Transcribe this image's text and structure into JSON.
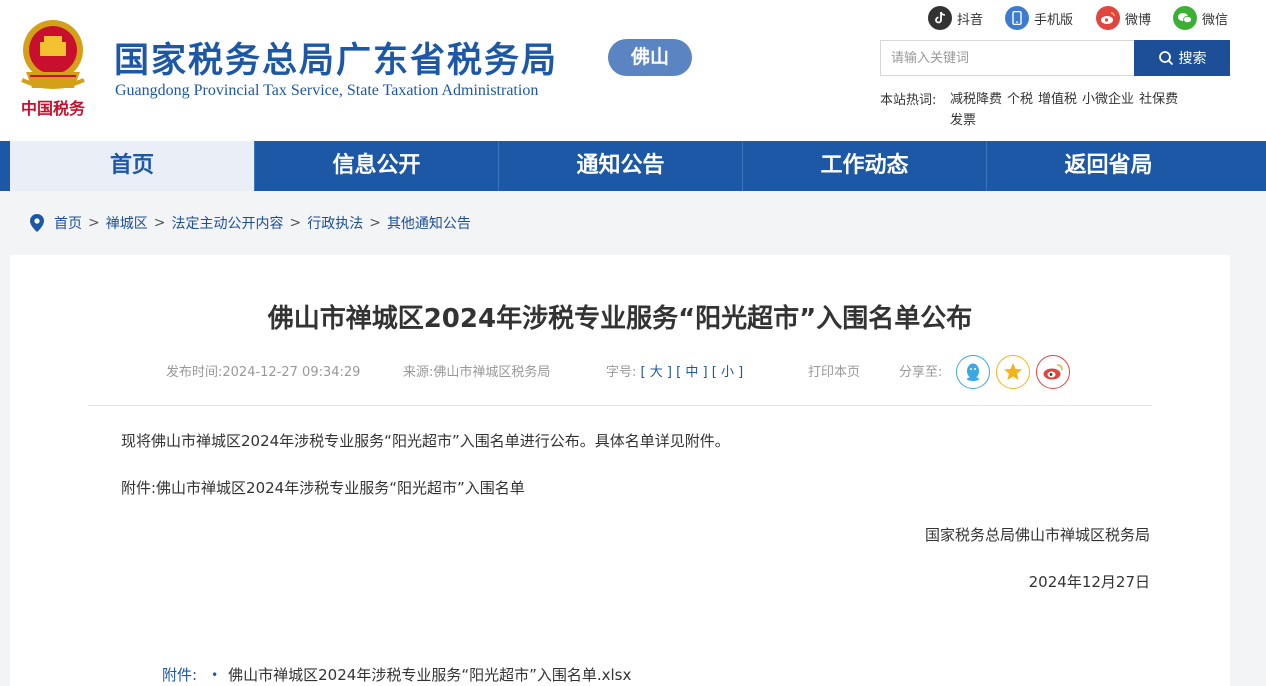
{
  "header": {
    "site_title": "国家税务总局广东省税务局",
    "site_subtitle": "Guangdong Provincial Tax Service, State Taxation Administration",
    "city_badge": "佛山",
    "social": [
      {
        "label": "抖音",
        "icon": "douyin-icon"
      },
      {
        "label": "手机版",
        "icon": "mobile-icon"
      },
      {
        "label": "微博",
        "icon": "weibo-icon"
      },
      {
        "label": "微信",
        "icon": "wechat-icon"
      }
    ],
    "search": {
      "placeholder": "请输入关键词",
      "button_label": "搜索"
    },
    "hot": {
      "label": "本站热词:",
      "items": [
        "减税降费",
        "个税",
        "增值税",
        "小微企业",
        "社保费",
        "发票"
      ]
    }
  },
  "nav": {
    "items": [
      "首页",
      "信息公开",
      "通知公告",
      "工作动态",
      "返回省局"
    ],
    "active_index": 0
  },
  "breadcrumb": [
    "首页",
    "禅城区",
    "法定主动公开内容",
    "行政执法",
    "其他通知公告"
  ],
  "article": {
    "title": "佛山市禅城区2024年涉税专业服务“阳光超市”入围名单公布",
    "meta": {
      "publish": "发布时间:2024-12-27 09:34:29",
      "source": "来源:佛山市禅城区税务局",
      "size_label": "字号:",
      "size_large": "大",
      "size_medium": "中",
      "size_small": "小",
      "print": "打印本页",
      "share_label": "分享至:"
    },
    "body": [
      "现将佛山市禅城区2024年涉税专业服务“阳光超市”入围名单进行公布。具体名单详见附件。",
      "附件:佛山市禅城区2024年涉税专业服务“阳光超市”入围名单"
    ],
    "signature": "国家税务总局佛山市禅城区税务局",
    "date": "2024年12月27日",
    "attachment": {
      "label": "附件:",
      "file": "佛山市禅城区2024年涉税专业服务“阳光超市”入围名单.xlsx"
    }
  },
  "colors": {
    "brand_blue": "#1d58a7",
    "nav_active_bg": "#e9eef7",
    "badge": "#5b84c3",
    "search_button": "#1d4f98"
  }
}
